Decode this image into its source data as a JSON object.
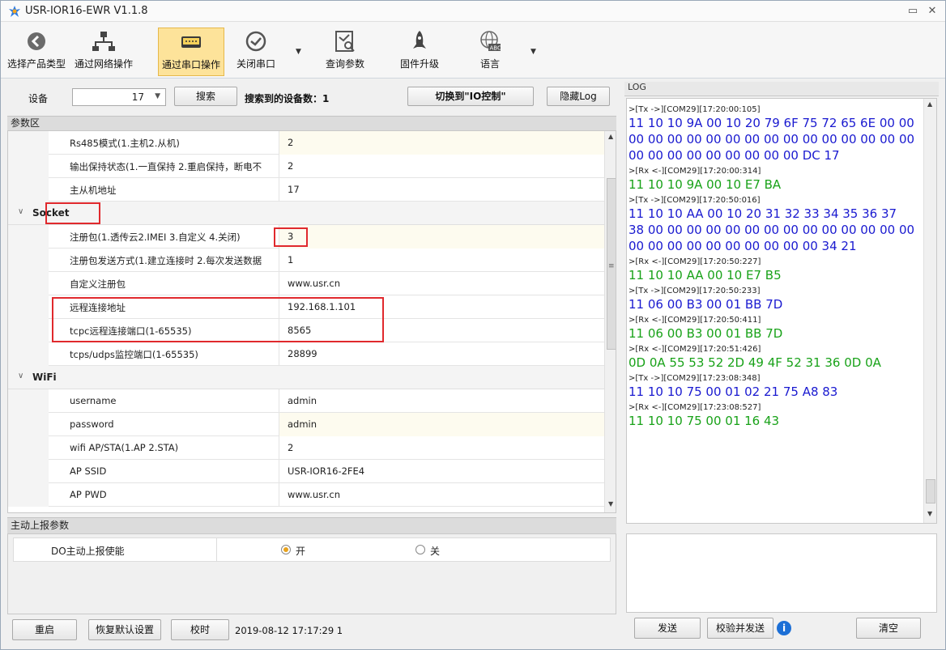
{
  "window": {
    "title": "USR-IOR16-EWR V1.1.8"
  },
  "toolbar": {
    "items": [
      {
        "label": "选择产品类型",
        "icon": "arrow-left-circle-icon"
      },
      {
        "label": "通过网络操作",
        "icon": "network-icon"
      },
      {
        "label": "通过串口操作",
        "icon": "serial-port-icon",
        "active": true
      },
      {
        "label": "关闭串口",
        "icon": "check-circle-icon"
      },
      {
        "label": "查询参数",
        "icon": "query-icon"
      },
      {
        "label": "固件升级",
        "icon": "rocket-icon"
      },
      {
        "label": "语言",
        "icon": "globe-abc-icon"
      }
    ]
  },
  "device_row": {
    "device_label": "设备",
    "device_value": "17",
    "search_button": "搜索",
    "found_text": "搜索到的设备数：1",
    "switch_button": "切换到\"IO控制\"",
    "hide_log_button": "隐藏Log"
  },
  "params": {
    "header": "参数区",
    "rows_top": [
      {
        "name": "Rs485模式(1.主机2.从机)",
        "value": "2"
      },
      {
        "name": "输出保持状态(1.一直保持 2.重启保持，断电不",
        "value": "2"
      },
      {
        "name": "主从机地址",
        "value": "17"
      }
    ],
    "socket": {
      "title": "Socket",
      "rows": [
        {
          "name": "注册包(1.透传云2.IMEI 3.自定义 4.关闭)",
          "value": "3"
        },
        {
          "name": "注册包发送方式(1.建立连接时 2.每次发送数据",
          "value": "1"
        },
        {
          "name": "自定义注册包",
          "value": "www.usr.cn"
        },
        {
          "name": "远程连接地址",
          "value": "192.168.1.101"
        },
        {
          "name": "tcpc远程连接端口(1-65535)",
          "value": "8565"
        },
        {
          "name": "tcps/udps监控端口(1-65535)",
          "value": "28899"
        }
      ]
    },
    "wifi": {
      "title": "WiFi",
      "rows": [
        {
          "name": "username",
          "value": "admin"
        },
        {
          "name": "password",
          "value": "admin"
        },
        {
          "name": "wifi AP/STA(1.AP 2.STA)",
          "value": "2"
        },
        {
          "name": "AP SSID",
          "value": "USR-IOR16-2FE4"
        },
        {
          "name": "AP PWD",
          "value": "www.usr.cn"
        }
      ]
    }
  },
  "report": {
    "header": "主动上报参数",
    "label": "DO主动上报使能",
    "option_on": "开",
    "option_off": "关",
    "selected": "开"
  },
  "bottom": {
    "restart": "重启",
    "restore": "恢复默认设置",
    "timing": "校时",
    "datetime": "2019-08-12 17:17:29 1"
  },
  "log": {
    "header": "LOG",
    "entries": [
      {
        "meta": ">[Tx ->][COM29][17:20:00:105]",
        "kind": "tx",
        "lines": [
          "11 10 10 9A 00 10 20 79 6F 75 72 65 6E 00 00",
          "00 00 00 00 00 00 00 00 00 00 00 00 00 00 00",
          "00 00 00 00 00 00 00 00 00 DC 17"
        ]
      },
      {
        "meta": ">[Rx <-][COM29][17:20:00:314]",
        "kind": "rx",
        "lines": [
          "11 10 10 9A 00 10 E7 BA"
        ]
      },
      {
        "meta": ">[Tx ->][COM29][17:20:50:016]",
        "kind": "tx",
        "lines": [
          "11 10 10 AA 00 10 20 31 32 33 34 35 36 37",
          "38 00 00 00 00 00 00 00 00 00 00 00 00 00 00",
          "00 00 00 00 00 00 00 00 00 00 34 21"
        ]
      },
      {
        "meta": ">[Rx <-][COM29][17:20:50:227]",
        "kind": "rx",
        "lines": [
          "11 10 10 AA 00 10 E7 B5"
        ]
      },
      {
        "meta": ">[Tx ->][COM29][17:20:50:233]",
        "kind": "tx",
        "lines": [
          "11 06 00 B3 00 01 BB 7D"
        ]
      },
      {
        "meta": ">[Rx <-][COM29][17:20:50:411]",
        "kind": "rx",
        "lines": [
          "11 06 00 B3 00 01 BB 7D"
        ]
      },
      {
        "meta": ">[Rx <-][COM29][17:20:51:426]",
        "kind": "rx",
        "lines": [
          "0D 0A 55 53 52 2D 49 4F 52 31 36 0D 0A"
        ]
      },
      {
        "meta": ">[Tx ->][COM29][17:23:08:348]",
        "kind": "tx",
        "lines": [
          "11 10 10 75 00 01 02 21 75 A8 83"
        ]
      },
      {
        "meta": ">[Rx <-][COM29][17:23:08:527]",
        "kind": "rx",
        "lines": [
          "11 10 10 75 00 01 16 43"
        ]
      }
    ],
    "send_button": "发送",
    "check_send_button": "校验并发送",
    "clear_button": "清空",
    "colors": {
      "tx": "#1a1ad0",
      "rx": "#19a219"
    }
  }
}
